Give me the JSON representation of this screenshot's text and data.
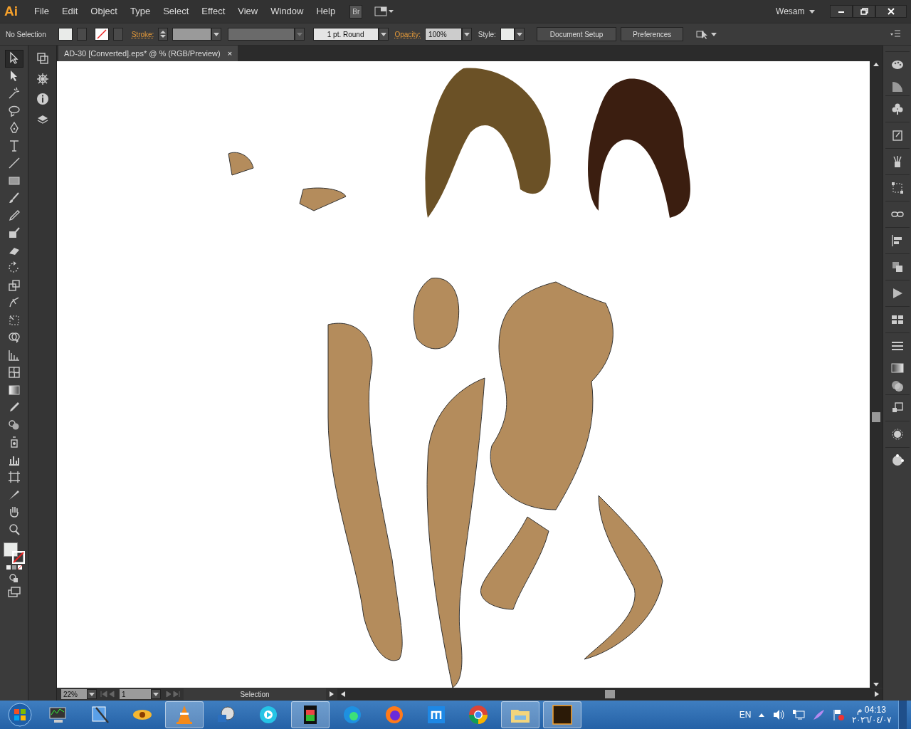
{
  "app": {
    "logo": "Ai",
    "menu": [
      "File",
      "Edit",
      "Object",
      "Type",
      "Select",
      "Effect",
      "View",
      "Window",
      "Help"
    ],
    "bridge_button": "Br",
    "user": "Wesam"
  },
  "control_bar": {
    "selection": "No Selection",
    "stroke_label": "Stroke:",
    "brush": "1 pt. Round",
    "opacity_label": "Opacity:",
    "opacity": "100%",
    "style_label": "Style:",
    "buttons": [
      "Document Setup",
      "Preferences"
    ]
  },
  "document_tab": {
    "title": "AD-30 [Converted].eps* @ % (RGB/Preview)",
    "close": "×"
  },
  "tools": [
    {
      "selected": true
    },
    {
      "selected": false
    },
    {
      "selected": false
    },
    {
      "selected": false
    },
    {
      "selected": false
    },
    {
      "selected": false
    },
    {
      "selected": false
    },
    {
      "selected": false
    },
    {
      "selected": false
    },
    {
      "selected": false
    },
    {
      "selected": false
    },
    {
      "selected": false
    },
    {
      "selected": false
    },
    {
      "selected": false
    },
    {
      "selected": false
    },
    {
      "selected": false
    },
    {
      "selected": false
    },
    {
      "selected": false
    },
    {
      "selected": false
    },
    {
      "selected": false
    },
    {
      "selected": false
    },
    {
      "selected": false
    },
    {
      "selected": false
    },
    {
      "selected": false
    },
    {
      "selected": false
    },
    {
      "selected": false
    },
    {
      "selected": false
    },
    {
      "selected": false
    }
  ],
  "status_bar": {
    "zoom": "22%",
    "artboard": "1",
    "tool": "Selection"
  },
  "taskbar": {
    "apps": [
      {
        "running": false
      },
      {
        "running": false
      },
      {
        "running": false
      },
      {
        "running": true
      },
      {
        "running": false
      },
      {
        "running": false
      },
      {
        "running": true
      },
      {
        "running": false
      },
      {
        "running": false
      },
      {
        "running": false
      },
      {
        "running": false
      },
      {
        "running": true
      },
      {
        "running": true
      }
    ],
    "language": "EN",
    "time": "04:13 م",
    "date": "٢٠٢٦/٠٤/٠٧"
  }
}
